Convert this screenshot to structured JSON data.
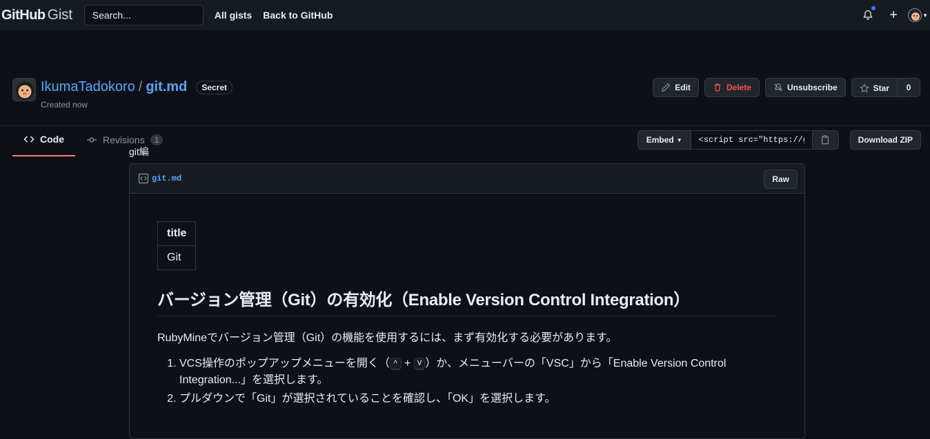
{
  "topbar": {
    "logo_github": "GitHub",
    "logo_gist": "Gist",
    "search_placeholder": "Search...",
    "links": [
      "All gists",
      "Back to GitHub"
    ]
  },
  "gist": {
    "owner": "IkumaTadokoro",
    "separator": "/",
    "filename": "git.md",
    "visibility": "Secret",
    "created": "Created now",
    "actions": {
      "edit": "Edit",
      "delete": "Delete",
      "unsubscribe": "Unsubscribe",
      "star": "Star",
      "star_count": "0"
    },
    "tabs": {
      "code": "Code",
      "revisions": "Revisions",
      "revisions_count": "1"
    },
    "embed": {
      "label": "Embed",
      "value": "<script src=\"https://gist.github.com/IkumaTadokoro/"
    },
    "download": "Download ZIP"
  },
  "file": {
    "description": "git編",
    "name": "git.md",
    "raw": "Raw",
    "table": {
      "header": "title",
      "value": "Git"
    },
    "heading": "バージョン管理（Git）の有効化（Enable Version Control Integration）",
    "intro": "RubyMineでバージョン管理（Git）の機能を使用するには、まず有効化する必要があります。",
    "step1_pre": "VCS操作のポップアップメニューを開く（",
    "step1_key1": "^",
    "step1_plus": "+",
    "step1_key2": "V",
    "step1_post": "）か、メニューバーの「VSC」から「Enable Version Control Integration...」を選択します。",
    "step2": "プルダウンで「Git」が選択されていることを確認し、「OK」を選択します。"
  },
  "colors": {
    "accent": "#58a6ff",
    "danger": "#f85149",
    "tab_underline": "#f78166",
    "background": "#0d1117",
    "header": "#161b22"
  }
}
